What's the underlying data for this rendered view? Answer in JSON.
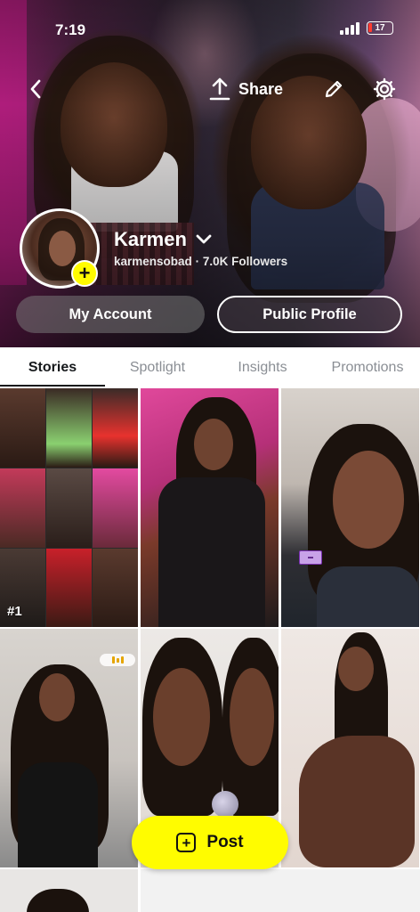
{
  "status_bar": {
    "time": "7:19",
    "battery_level": "17"
  },
  "header": {
    "back_icon": "chevron-left-icon",
    "share_label": "Share",
    "share_icon": "share-upload-icon",
    "edit_icon": "pencil-icon",
    "settings_icon": "gear-icon"
  },
  "profile": {
    "display_name": "Karmen",
    "username": "karmensobad",
    "separator": "·",
    "followers": "7.0K Followers",
    "add_story_symbol": "+"
  },
  "buttons": {
    "my_account": "My Account",
    "public_profile": "Public Profile"
  },
  "tabs": [
    {
      "label": "Stories",
      "active": true
    },
    {
      "label": "Spotlight",
      "active": false
    },
    {
      "label": "Insights",
      "active": false
    },
    {
      "label": "Promotions",
      "active": false
    }
  ],
  "grid": {
    "first_tile_rank": "#1"
  },
  "post_button": {
    "label": "Post",
    "icon": "plus-square-icon"
  },
  "colors": {
    "accent_yellow": "#fffc00",
    "tab_active": "#16191c",
    "tab_inactive": "#8a8e94"
  }
}
